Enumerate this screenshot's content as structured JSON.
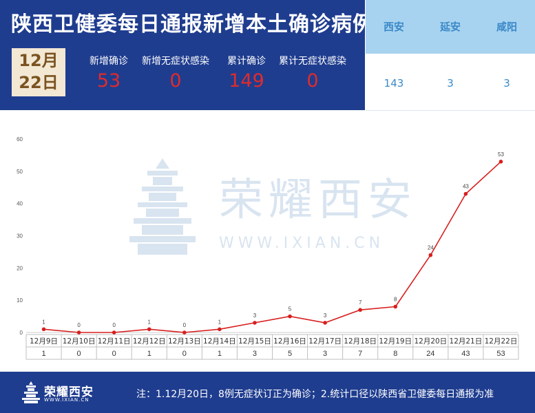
{
  "header": {
    "title": "陕西卫健委每日通报新增本土确诊病例",
    "date_line1": "12月",
    "date_line2": "22日",
    "stats": [
      {
        "label": "新增确诊",
        "value": "53"
      },
      {
        "label": "新增无症状感染",
        "value": "0"
      },
      {
        "label": "累计确诊",
        "value": "149"
      },
      {
        "label": "累计无症状感染",
        "value": "0"
      }
    ]
  },
  "cities": [
    {
      "name": "西安",
      "value": "143"
    },
    {
      "name": "延安",
      "value": "3"
    },
    {
      "name": "咸阳",
      "value": "3"
    }
  ],
  "watermark": {
    "brand": "荣耀西安",
    "url": "WWW.IXIAN.CN"
  },
  "footer": {
    "brand": "荣耀西安",
    "url": "WWW.IXIAN.CN",
    "note": "注：1.12月20日，8例无症状订正为确诊；2.统计口径以陕西省卫健委每日通报为准"
  },
  "colors": {
    "header_bg": "#1f3d8f",
    "accent_red": "#e02b2b",
    "city_blue": "#3a89c8",
    "city_header_bg": "#a8d3f0",
    "date_box_bg": "#f3e8d4",
    "line": "#d81e1e"
  },
  "chart_data": {
    "type": "line",
    "categories": [
      "12月9日",
      "12月10日",
      "12月11日",
      "12月12日",
      "12月13日",
      "12月14日",
      "12月15日",
      "12月16日",
      "12月17日",
      "12月18日",
      "12月19日",
      "12月20日",
      "12月21日",
      "12月22日"
    ],
    "values": [
      1,
      0,
      0,
      1,
      0,
      1,
      3,
      5,
      3,
      7,
      8,
      24,
      43,
      53
    ],
    "ylim": [
      0,
      60
    ],
    "yticks": [
      0,
      10,
      20,
      30,
      40,
      50,
      60
    ],
    "grid": false,
    "legend": "none",
    "data_table": true
  }
}
